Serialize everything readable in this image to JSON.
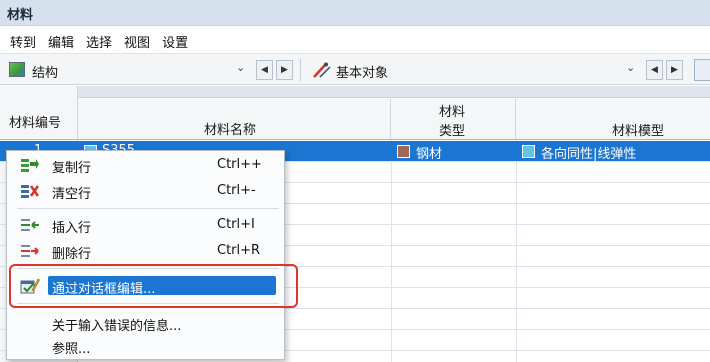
{
  "window": {
    "title": "材料"
  },
  "menu": [
    "转到",
    "编辑",
    "选择",
    "视图",
    "设置"
  ],
  "toolbar": {
    "structure_label": "结构",
    "object_label": "基本对象",
    "dropdown_arrow": "⌄",
    "prev_glyph": "◀",
    "next_glyph": "▶"
  },
  "table": {
    "headers": {
      "no": "材料编号",
      "name": "材料名称",
      "type_line1": "材料",
      "type_line2": "类型",
      "model": "材料模型"
    },
    "selected_row": {
      "no": "1",
      "name": "S355",
      "type": "钢材",
      "model": "各向同性|线弹性",
      "type_color": "#a0675a",
      "model_color": "#5ec5e6",
      "name_color": "#5ec5e6"
    }
  },
  "context_menu": {
    "items": [
      {
        "label": "复制行",
        "shortcut": "Ctrl++",
        "icon": "copy-row-icon"
      },
      {
        "label": "清空行",
        "shortcut": "Ctrl+-",
        "icon": "clear-row-icon"
      },
      {
        "label": "插入行",
        "shortcut": "Ctrl+I",
        "icon": "insert-row-icon"
      },
      {
        "label": "删除行",
        "shortcut": "Ctrl+R",
        "icon": "delete-row-icon"
      },
      {
        "label": "通过对话框编辑...",
        "shortcut": "",
        "icon": "edit-dialog-icon",
        "highlighted": true
      },
      {
        "label": "关于输入错误的信息...",
        "shortcut": ""
      },
      {
        "label": "参照...",
        "shortcut": ""
      }
    ]
  },
  "colors": {
    "accent": "#1b76d2",
    "annotation": "#e0342a"
  }
}
